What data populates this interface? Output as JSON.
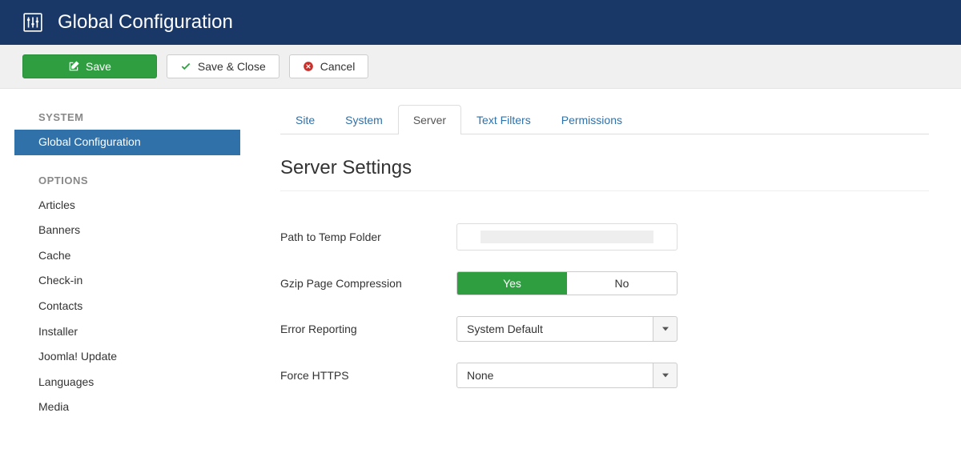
{
  "header": {
    "title": "Global Configuration"
  },
  "toolbar": {
    "save": "Save",
    "save_close": "Save & Close",
    "cancel": "Cancel"
  },
  "sidebar": {
    "system_heading": "SYSTEM",
    "system_items": [
      {
        "label": "Global Configuration",
        "active": true
      }
    ],
    "options_heading": "OPTIONS",
    "options_items": [
      {
        "label": "Articles"
      },
      {
        "label": "Banners"
      },
      {
        "label": "Cache"
      },
      {
        "label": "Check-in"
      },
      {
        "label": "Contacts"
      },
      {
        "label": "Installer"
      },
      {
        "label": "Joomla! Update"
      },
      {
        "label": "Languages"
      },
      {
        "label": "Media"
      }
    ]
  },
  "tabs": [
    {
      "label": "Site",
      "active": false
    },
    {
      "label": "System",
      "active": false
    },
    {
      "label": "Server",
      "active": true
    },
    {
      "label": "Text Filters",
      "active": false
    },
    {
      "label": "Permissions",
      "active": false
    }
  ],
  "section_title": "Server Settings",
  "form": {
    "path_label": "Path to Temp Folder",
    "path_value": "",
    "gzip_label": "Gzip Page Compression",
    "gzip_yes": "Yes",
    "gzip_no": "No",
    "gzip_selected": "Yes",
    "error_label": "Error Reporting",
    "error_value": "System Default",
    "https_label": "Force HTTPS",
    "https_value": "None"
  }
}
